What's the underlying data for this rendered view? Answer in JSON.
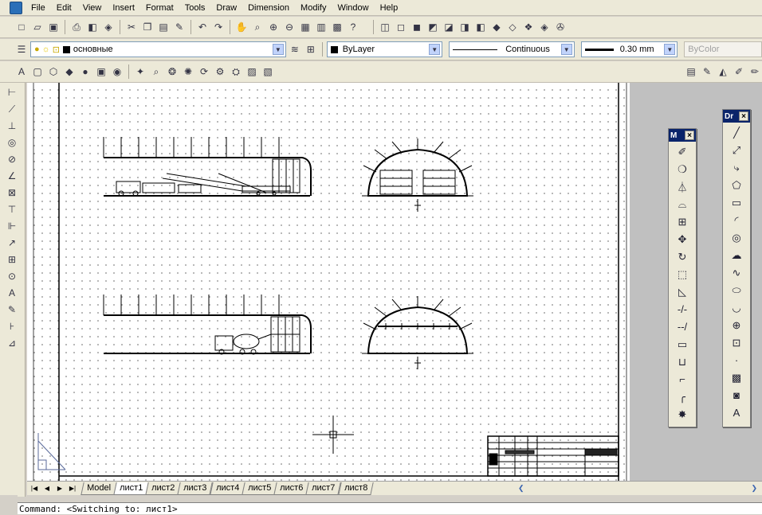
{
  "menu": {
    "items": [
      "File",
      "Edit",
      "View",
      "Insert",
      "Format",
      "Tools",
      "Draw",
      "Dimension",
      "Modify",
      "Window",
      "Help"
    ]
  },
  "properties": {
    "layer": "основные",
    "color": "ByLayer",
    "linetype": "Continuous",
    "lineweight": "0.30 mm",
    "plotstyle": "ByColor"
  },
  "palettes": {
    "modify": {
      "title": "M"
    },
    "draw": {
      "title": "Dr"
    }
  },
  "tabs": [
    "Model",
    "лист1",
    "лист2",
    "лист3",
    "лист4",
    "лист5",
    "лист6",
    "лист7",
    "лист8"
  ],
  "command": {
    "text": "Command:  <Switching to: лист1>"
  },
  "colors": {
    "layer_swatch": "#000000",
    "title_bar": "#0a246a"
  }
}
